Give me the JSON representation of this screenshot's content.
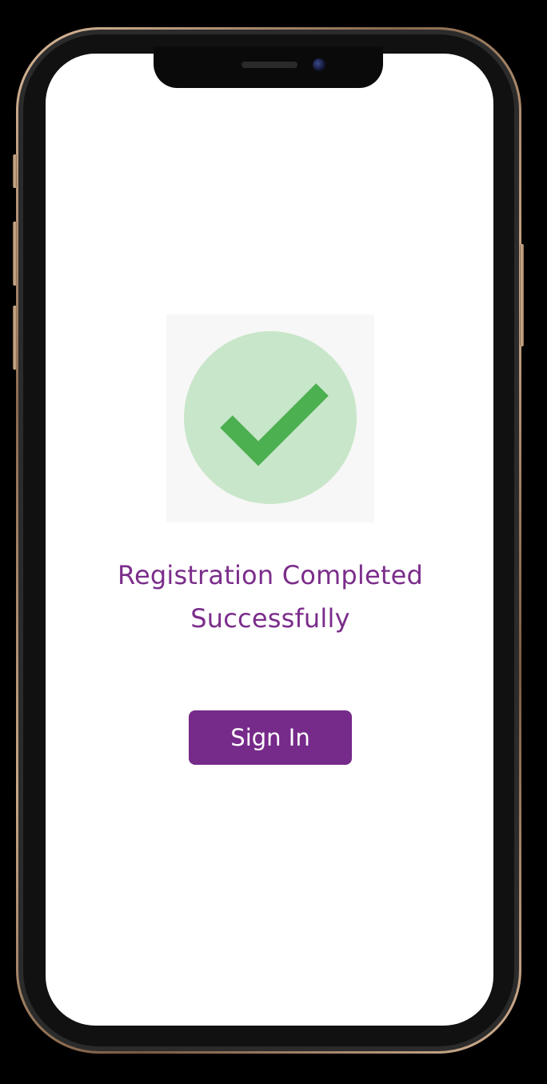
{
  "message": {
    "line1": "Registration Completed",
    "line2": "Successfully"
  },
  "signin_button": {
    "label": "Sign In"
  },
  "colors": {
    "accent": "#762a8a",
    "message_text": "#7b2d8b",
    "success_circle": "#c8e6c9",
    "checkmark": "#4caf50",
    "screen_background": "#ffffff",
    "page_background": "#000000"
  },
  "icons": {
    "success": "check-circle-icon"
  }
}
